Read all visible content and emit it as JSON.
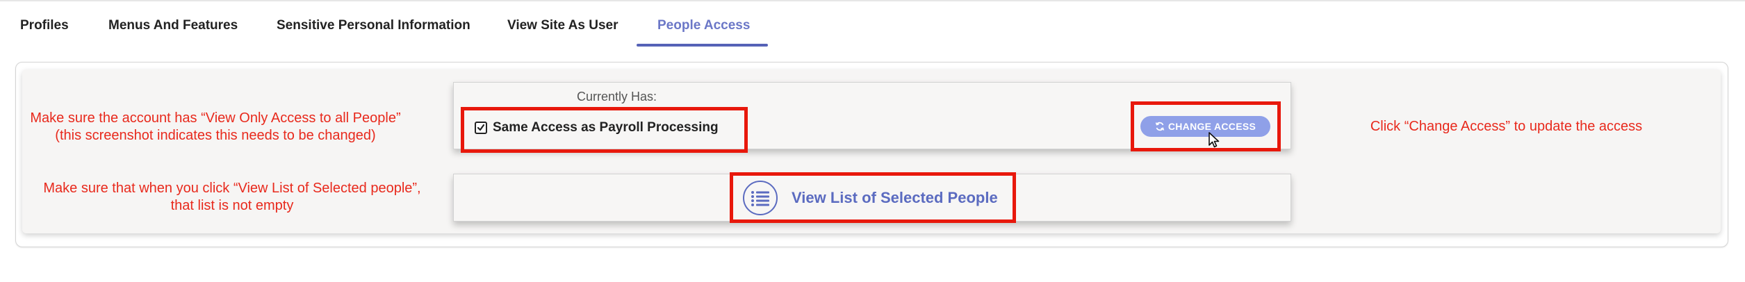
{
  "tabs": [
    {
      "label": "Profiles"
    },
    {
      "label": "Menus And Features"
    },
    {
      "label": "Sensitive Personal Information"
    },
    {
      "label": "View Site As User"
    },
    {
      "label": "People Access"
    }
  ],
  "active_tab": "People Access",
  "access": {
    "currently_label": "Currently Has:",
    "checkbox_label": "Same Access as Payroll Processing",
    "checkbox_checked": true,
    "change_button_label": "CHANGE ACCESS",
    "view_list_label": "View List of Selected People"
  },
  "annotations": {
    "note1_line1": "Make sure the account has “View Only Access to all People”",
    "note1_line2": "(this screenshot indicates this needs to be changed)",
    "note2_line1": "Make sure that when you click “View List of Selected people”,",
    "note2_line2": "that list is not empty",
    "note3": "Click “Change Access” to update the access"
  },
  "colors": {
    "accent": "#5662b7",
    "button": "#8fa0e8",
    "annotation_red": "#e8180c"
  },
  "icons": {
    "checkbox": "checkbox-checked-icon",
    "refresh": "refresh-icon",
    "list": "list-icon",
    "cursor": "mouse-pointer-icon"
  }
}
